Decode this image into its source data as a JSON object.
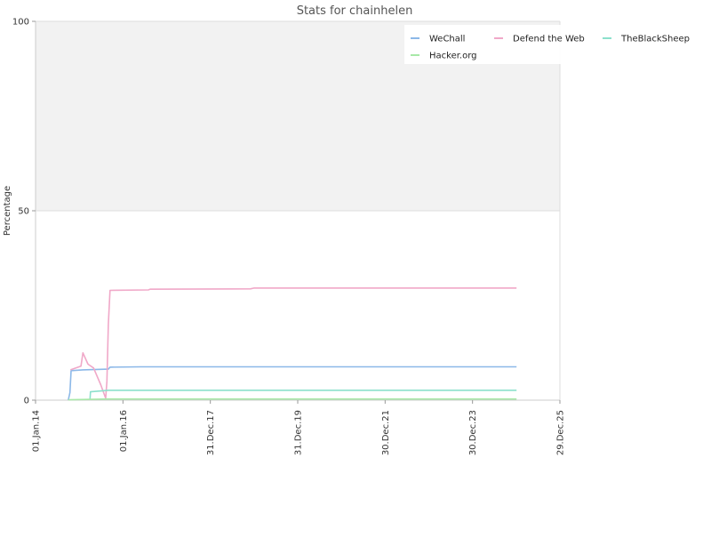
{
  "chart_data": {
    "type": "line",
    "title": "Stats for chainhelen",
    "xlabel": "",
    "ylabel": "Percentage",
    "ylim": [
      0,
      100
    ],
    "y_ticks": [
      0,
      50,
      100
    ],
    "x_tick_labels": [
      "01.Jan.14",
      "01.Jan.16",
      "31.Dec.17",
      "31.Dec.19",
      "30.Dec.21",
      "30.Dec.23",
      "29.Dec.25"
    ],
    "background_bands": [
      {
        "from": 50,
        "to": 100,
        "color": "#f2f2f2"
      }
    ],
    "legend_position": "top-right",
    "series": [
      {
        "name": "WeChall",
        "color": "#8cb8e8",
        "points": [
          [
            "2014-10-01",
            0
          ],
          [
            "2014-10-15",
            2
          ],
          [
            "2014-10-25",
            7.8
          ],
          [
            "2015-02-01",
            8.0
          ],
          [
            "2015-09-01",
            8.2
          ],
          [
            "2015-09-15",
            8.7
          ],
          [
            "2016-06-01",
            8.8
          ],
          [
            "2025-01-01",
            8.8
          ]
        ]
      },
      {
        "name": "Defend the Web",
        "color": "#f0a8c8",
        "points": [
          [
            "2014-10-20",
            8.0
          ],
          [
            "2015-01-15",
            9.0
          ],
          [
            "2015-02-01",
            12.5
          ],
          [
            "2015-03-15",
            9.5
          ],
          [
            "2015-05-01",
            8.5
          ],
          [
            "2015-07-01",
            4.0
          ],
          [
            "2015-08-10",
            0.5
          ],
          [
            "2015-08-20",
            5.0
          ],
          [
            "2015-09-01",
            20.0
          ],
          [
            "2015-09-15",
            29.0
          ],
          [
            "2016-08-01",
            29.1
          ],
          [
            "2016-08-15",
            29.3
          ],
          [
            "2018-12-01",
            29.4
          ],
          [
            "2019-01-01",
            29.6
          ],
          [
            "2025-01-01",
            29.6
          ]
        ]
      },
      {
        "name": "TheBlackSheep",
        "color": "#8ce0cc",
        "points": [
          [
            "2015-04-01",
            0.3
          ],
          [
            "2015-04-05",
            2.2
          ],
          [
            "2015-09-01",
            2.6
          ],
          [
            "2025-01-01",
            2.6
          ]
        ]
      },
      {
        "name": "Hacker.org",
        "color": "#a8e8a8",
        "points": [
          [
            "2014-10-01",
            0.1
          ],
          [
            "2015-09-01",
            0.3
          ],
          [
            "2025-01-01",
            0.3
          ]
        ]
      }
    ]
  }
}
